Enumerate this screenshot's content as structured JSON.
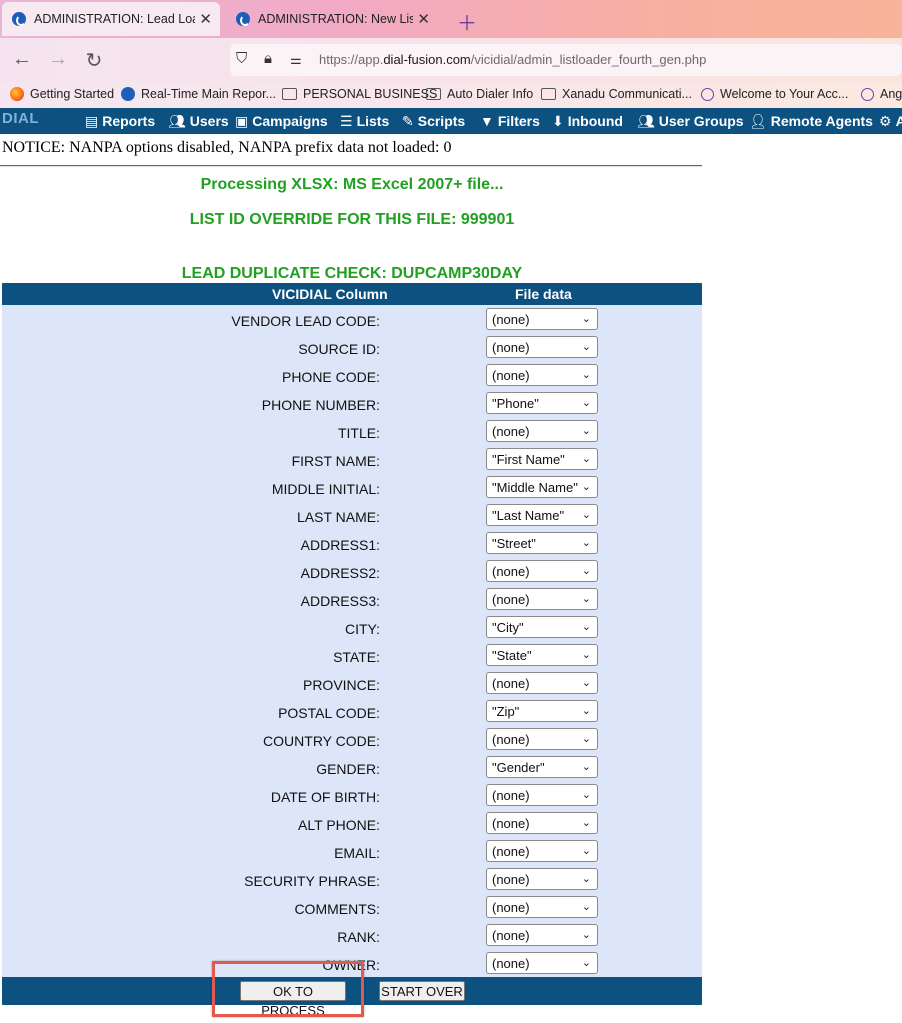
{
  "browser": {
    "tabs": [
      {
        "title": "ADMINISTRATION: Lead Loader",
        "active": true,
        "icon": "dial-fusion-favicon"
      },
      {
        "title": "ADMINISTRATION: New List Ad",
        "active": false,
        "icon": "dial-fusion-favicon"
      }
    ],
    "url": {
      "prefix": "https://app.",
      "domain": "dial-fusion.com",
      "path": "/vicidial/admin_listloader_fourth_gen.php"
    },
    "bookmarks": [
      {
        "label": "Getting Started",
        "icon": "firefox-icon"
      },
      {
        "label": "Real-Time Main Repor...",
        "icon": "dial-fusion-favicon"
      },
      {
        "label": "PERSONAL BUSINESS",
        "icon": "folder-icon"
      },
      {
        "label": "Auto Dialer Info",
        "icon": "folder-icon"
      },
      {
        "label": "Xanadu Communicati...",
        "icon": "folder-icon"
      },
      {
        "label": "Welcome to Your Acc...",
        "icon": "globe-icon"
      },
      {
        "label": "Ang",
        "icon": "globe-icon"
      }
    ]
  },
  "app": {
    "logo": "DIAL",
    "menu": [
      {
        "label": "Reports",
        "icon": "reports-icon"
      },
      {
        "label": "Users",
        "icon": "users-icon"
      },
      {
        "label": "Campaigns",
        "icon": "campaigns-icon"
      },
      {
        "label": "Lists",
        "icon": "lists-icon"
      },
      {
        "label": "Scripts",
        "icon": "scripts-icon"
      },
      {
        "label": "Filters",
        "icon": "filters-icon"
      },
      {
        "label": "Inbound",
        "icon": "inbound-icon"
      },
      {
        "label": "User Groups",
        "icon": "user-groups-icon"
      },
      {
        "label": "Remote Agents",
        "icon": "remote-agents-icon"
      },
      {
        "label": "A",
        "icon": "gear-icon"
      }
    ],
    "accent_color": "#0d5180",
    "success_color": "#22a022"
  },
  "page": {
    "notice": "NOTICE: NANPA options disabled, NANPA prefix data not loaded: 0",
    "processing": "Processing XLSX: MS Excel 2007+ file...",
    "list_override": "LIST ID OVERRIDE FOR THIS FILE: 999901",
    "dup_check": "LEAD DUPLICATE CHECK: DUPCAMP30DAY",
    "table": {
      "col_vicidial": "VICIDIAL Column",
      "col_file": "File data",
      "rows": [
        {
          "label": "VENDOR LEAD CODE:",
          "value": "(none)"
        },
        {
          "label": "SOURCE ID:",
          "value": "(none)"
        },
        {
          "label": "PHONE CODE:",
          "value": "(none)"
        },
        {
          "label": "PHONE NUMBER:",
          "value": "\"Phone\""
        },
        {
          "label": "TITLE:",
          "value": "(none)"
        },
        {
          "label": "FIRST NAME:",
          "value": "\"First Name\""
        },
        {
          "label": "MIDDLE INITIAL:",
          "value": "\"Middle Name\""
        },
        {
          "label": "LAST NAME:",
          "value": "\"Last Name\""
        },
        {
          "label": "ADDRESS1:",
          "value": "\"Street\""
        },
        {
          "label": "ADDRESS2:",
          "value": "(none)"
        },
        {
          "label": "ADDRESS3:",
          "value": "(none)"
        },
        {
          "label": "CITY:",
          "value": "\"City\""
        },
        {
          "label": "STATE:",
          "value": "\"State\""
        },
        {
          "label": "PROVINCE:",
          "value": "(none)"
        },
        {
          "label": "POSTAL CODE:",
          "value": "\"Zip\""
        },
        {
          "label": "COUNTRY CODE:",
          "value": "(none)"
        },
        {
          "label": "GENDER:",
          "value": "\"Gender\""
        },
        {
          "label": "DATE OF BIRTH:",
          "value": "(none)"
        },
        {
          "label": "ALT PHONE:",
          "value": "(none)"
        },
        {
          "label": "EMAIL:",
          "value": "(none)"
        },
        {
          "label": "SECURITY PHRASE:",
          "value": "(none)"
        },
        {
          "label": "COMMENTS:",
          "value": "(none)"
        },
        {
          "label": "RANK:",
          "value": "(none)"
        },
        {
          "label": "OWNER:",
          "value": "(none)"
        }
      ]
    },
    "buttons": {
      "ok": "OK TO PROCESS",
      "start_over": "START OVER"
    }
  }
}
